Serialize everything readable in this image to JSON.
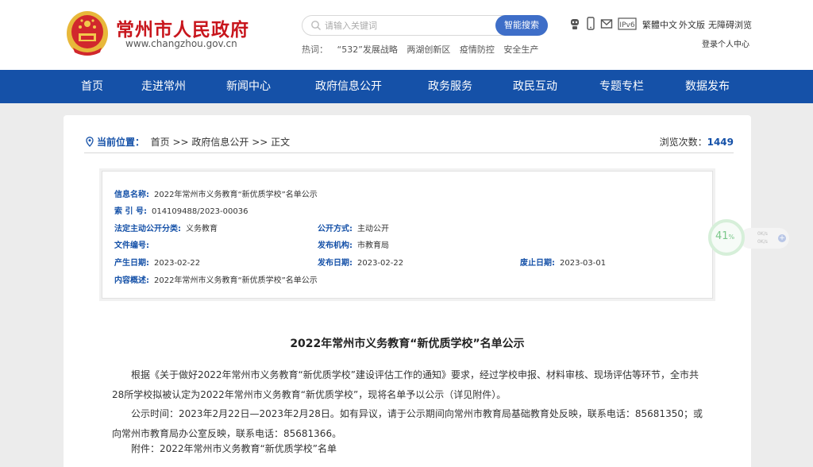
{
  "header": {
    "site_title": "常州市人民政府",
    "site_url": "www.changzhou.gov.cn",
    "search": {
      "placeholder": "请输入关键词",
      "button": "智能搜索"
    },
    "hot_label": "热词：",
    "hot_words": [
      "“532”发展战略",
      "两湖创新区",
      "疫情防控",
      "安全生产"
    ],
    "lang_links": [
      "繁體中文",
      "外文版",
      "无障碍浏览"
    ],
    "login": "登录个人中心",
    "tool_icons": [
      "robot-icon",
      "mobile-icon",
      "mail-icon",
      "ipv6-icon"
    ]
  },
  "nav": [
    "首页",
    "走进常州",
    "新闻中心",
    "政府信息公开",
    "政务服务",
    "政民互动",
    "专题专栏",
    "数据发布"
  ],
  "breadcrumb": {
    "label": "当前位置：",
    "path": "首页 >> 政府信息公开 >> 正文"
  },
  "views": {
    "label": "浏览次数：",
    "count": "1449"
  },
  "info": {
    "name_k": "信息名称:",
    "name_v": "2022年常州市义务教育“新优质学校”名单公示",
    "index_k": "索 引 号:",
    "index_v": "014109488/2023-00036",
    "category_k": "法定主动公开分类:",
    "category_v": "义务教育",
    "mode_k": "公开方式:",
    "mode_v": "主动公开",
    "docno_k": "文件编号:",
    "docno_v": "",
    "org_k": "发布机构:",
    "org_v": "市教育局",
    "created_k": "产生日期:",
    "created_v": "2023-02-22",
    "published_k": "发布日期:",
    "published_v": "2023-02-22",
    "expire_k": "废止日期:",
    "expire_v": "2023-03-01",
    "summary_k": "内容概述:",
    "summary_v": "2022年常州市义务教育“新优质学校”名单公示"
  },
  "article": {
    "title": "2022年常州市义务教育“新优质学校”名单公示",
    "p1": "根据《关于做好2022年常州市义务教育“新优质学校”建设评估工作的通知》要求，经过学校申报、材料审核、现场评估等环节，全市共28所学校拟被认定为2022年常州市义务教育“新优质学校”，现将名单予以公示（详见附件）。",
    "p2": "公示时间：2023年2月22日—2023年2月28日。如有异议，请于公示期间向常州市教育局基础教育处反映，联系电话：85681350；或向常州市教育局办公室反映，联系电话：85681366。",
    "p3": "附件：2022年常州市义务教育“新优质学校”名单"
  },
  "widget": {
    "percent": "41",
    "unit": "%",
    "up": "0K/s",
    "down": "0K/s",
    "plus": "+"
  },
  "colors": {
    "brand_red": "#c8161d",
    "nav_blue": "#1551a8",
    "search_btn": "#3e6ec8"
  }
}
